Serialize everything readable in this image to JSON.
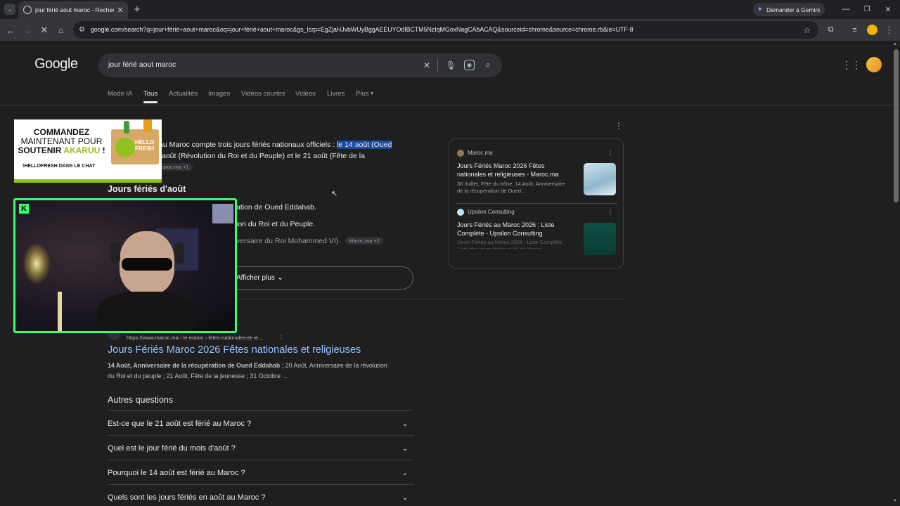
{
  "browser": {
    "tab_title": "jour férié aout maroc - Recherche",
    "new_tab": "+",
    "gemini_button": "Demander à Gemini",
    "url": "google.com/search?q=jour+férié+aout+maroc&oq=jour+férié+aout+maroc&gs_lcrp=EgZjaHJvbWUyBggAEEUYOdIBCTM5NzIqMGoxNagCAbACAQ&sourceid=chrome&source=chrome.rb&ie=UTF-8"
  },
  "search": {
    "logo": "Google",
    "query": "jour férié aout maroc"
  },
  "nav_tabs": [
    {
      "label": "Mode IA"
    },
    {
      "label": "Tous"
    },
    {
      "label": "Actualités"
    },
    {
      "label": "Images"
    },
    {
      "label": "Vidéos courtes"
    },
    {
      "label": "Vidéos"
    },
    {
      "label": "Livres"
    },
    {
      "label": "Plus"
    }
  ],
  "overview": {
    "text_line1_a": "au Maroc compte trois jours fériés nationaux officiels : ",
    "text_line1_highlight": "le 14 août (Oued",
    "text_line2": "août (Révolution du Roi et du Peuple) et le 21 août (Fête de la",
    "source_chip": "aroc.ma +1",
    "heading": "Jours fériés d'août",
    "item1": "ation de Oued Eddahab.",
    "item2": "ion du Roi et du Peuple.",
    "item3": "versaire du Roi Mohammed VI).",
    "item3_chip": "Maroc.ma +2",
    "show_more": "Afficher plus"
  },
  "side_panel": {
    "cards": [
      {
        "source": "Maroc.ma",
        "title": "Jours Fériés Maroc 2026 Fêtes nationales et religieuses - Maroc.ma",
        "snippet": "30 Juillet, Fête du trône. 14 Août, Anniversaire de la récupération de Oued…"
      },
      {
        "source": "Upsilon Consulting",
        "title": "Jours Fériés au Maroc 2026 : Liste Complète - Upsilon Consulting",
        "snippet": "Jours Fériés au Maroc 2026 : Liste Complète · Liste des jours fériés civils au Maroc"
      }
    ]
  },
  "result": {
    "url": "https://www.maroc.ma › le-maroc › fetes-nationales-et-re...",
    "title": "Jours Fériés Maroc 2026 Fêtes nationales et religieuses",
    "snippet_bold": "14 Août, Anniversaire de la récupération de Oued Eddahab",
    "snippet_rest": " ; 20 Août, Anniversaire de la révolution",
    "snippet_line2": "du Roi et du peuple ; 21 Août, Fête de la jeunesse ; 31 Octobre ..."
  },
  "questions": {
    "heading": "Autres questions",
    "items": [
      {
        "text": "Est-ce que le 21 août est férié au Maroc ?"
      },
      {
        "text": "Quel est le jour férié du mois d'août ?"
      },
      {
        "text": "Pourquoi le 14 août est férié au Maroc ?"
      },
      {
        "text": "Quels sont les jours fériés en août au Maroc ?"
      }
    ]
  },
  "ad_overlay": {
    "line1": "COMMANDEZ",
    "line2": "MAINTENANT POUR",
    "line3a": "SOUTENIR ",
    "line3b": "AKARUU",
    "line3c": " !",
    "tag": "!HELLOFRESH DANS LE CHAT",
    "box_label1": "HELLO",
    "box_label2": "FRESH"
  },
  "colors": {
    "page_bg": "#1f1f1f",
    "link": "#99c3ff",
    "webcam_border": "#39ff6a",
    "highlight": "#184b9e",
    "hellofresh_green": "#91c11e"
  }
}
